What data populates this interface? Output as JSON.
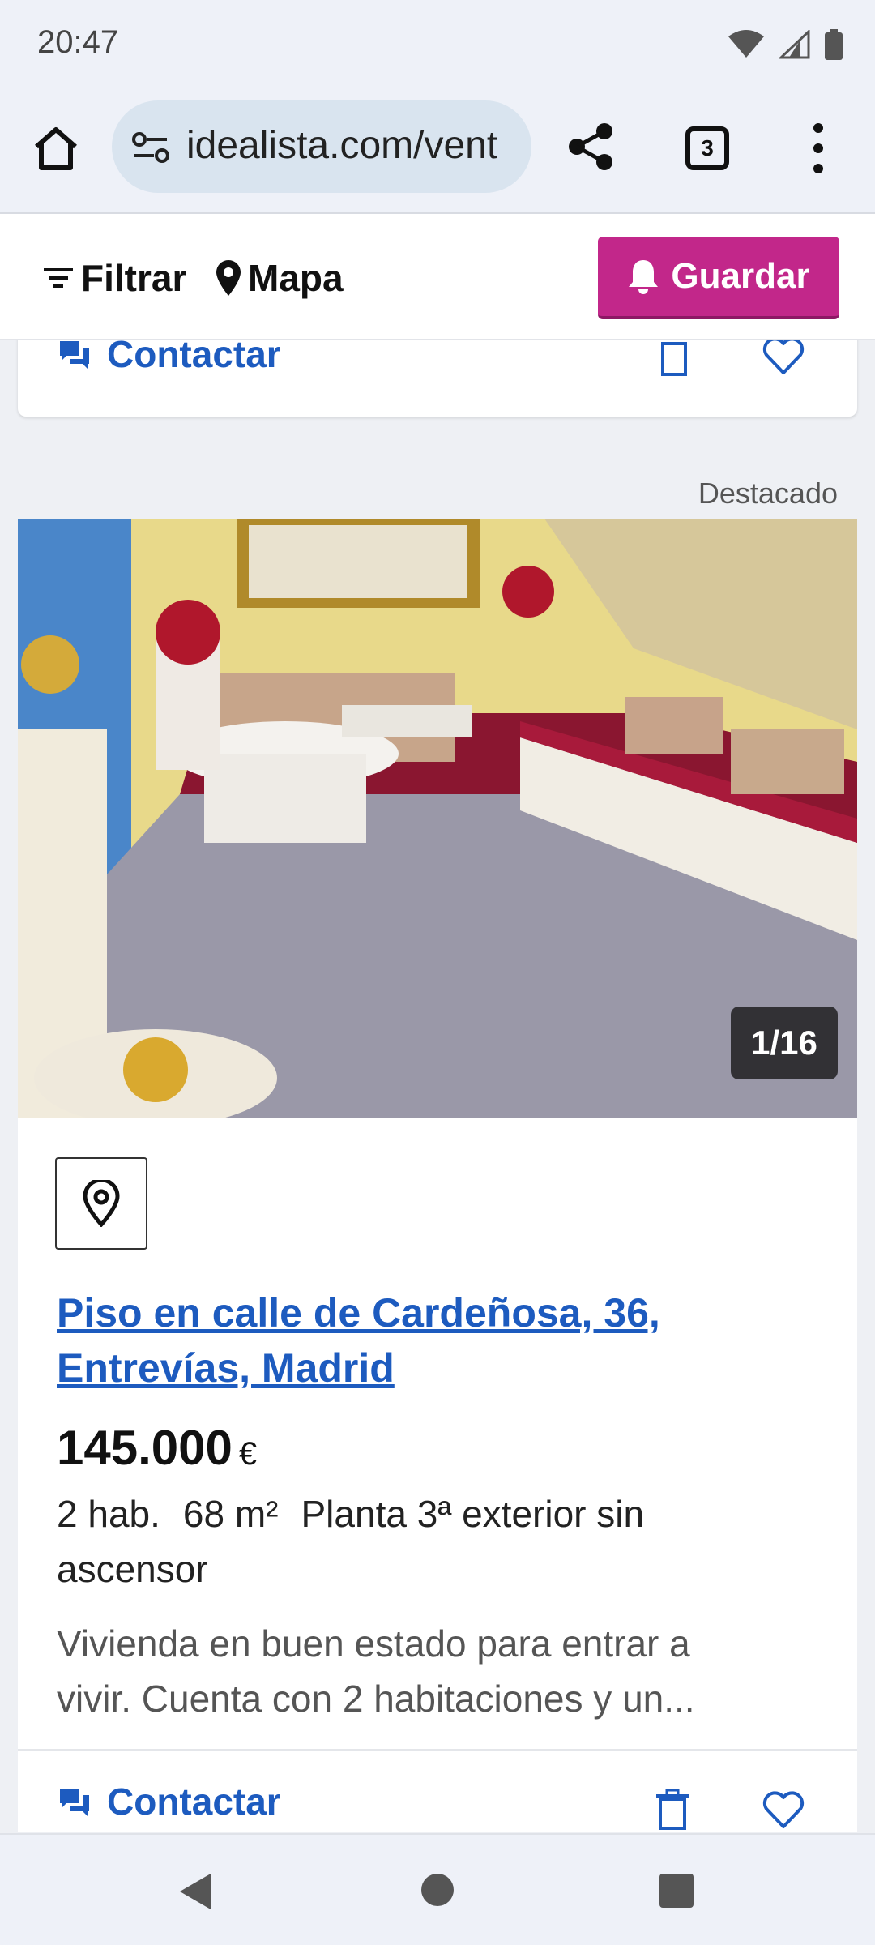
{
  "status": {
    "time": "20:47"
  },
  "browser": {
    "url": "idealista.com/vent",
    "tab_count": "3"
  },
  "filters": {
    "filter_label": "Filtrar",
    "map_label": "Mapa",
    "save_label": "Guardar"
  },
  "previous_card": {
    "contact_label": "Contactar"
  },
  "listing": {
    "badge": "Destacado",
    "photo_counter": "1/16",
    "title_line1": "Piso en calle de Cardeñosa, 36,",
    "title_line2": "Entrevías, Madrid",
    "price": "145.000",
    "currency": "€",
    "rooms": "2 hab.",
    "area": "68 m²",
    "floor": "Planta 3ª exterior sin ascensor",
    "description_line1": "Vivienda en buen estado para entrar a",
    "description_line2": "vivir. Cuenta con 2 habitaciones y un...",
    "contact_label": "Contactar"
  },
  "colors": {
    "brand": "#c2278a",
    "link": "#1d5bbf"
  }
}
